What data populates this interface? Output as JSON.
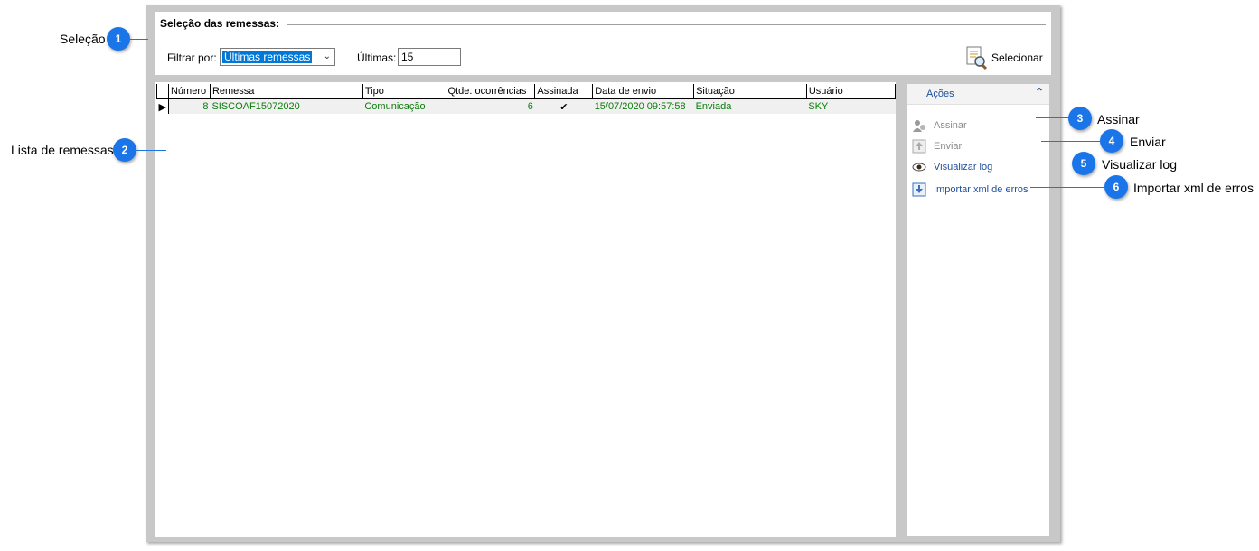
{
  "selection": {
    "title": "Seleção das remessas:",
    "filter_label": "Filtrar por:",
    "filter_value": "Últimas remessas",
    "last_label": "Últimas:",
    "last_value": "15",
    "select_button": "Selecionar"
  },
  "grid": {
    "columns": [
      "Número",
      "Remessa",
      "Tipo",
      "Qtde. ocorrências",
      "Assinada",
      "Data de envio",
      "Situação",
      "Usuário"
    ],
    "rows": [
      {
        "numero": "8",
        "remessa": "SISCOAF15072020",
        "tipo": "Comunicação",
        "qtde": "6",
        "assinada": "✔",
        "data": "15/07/2020 09:57:58",
        "situacao": "Enviada",
        "usuario": "SKY"
      }
    ]
  },
  "actions": {
    "header": "Ações",
    "items": [
      {
        "label": "Assinar",
        "icon": "signature-icon",
        "enabled": false
      },
      {
        "label": "Enviar",
        "icon": "upload-icon",
        "enabled": false
      },
      {
        "label": "Visualizar log",
        "icon": "eye-icon",
        "enabled": true
      },
      {
        "label": "Importar xml de erros",
        "icon": "import-icon",
        "enabled": true
      }
    ]
  },
  "callouts": [
    {
      "num": "1",
      "text": "Seleção"
    },
    {
      "num": "2",
      "text": "Lista de remessas"
    },
    {
      "num": "3",
      "text": "Assinar"
    },
    {
      "num": "4",
      "text": "Enviar"
    },
    {
      "num": "5",
      "text": "Visualizar log"
    },
    {
      "num": "6",
      "text": "Importar xml de erros"
    }
  ],
  "colors": {
    "accent": "#1a75e8",
    "link": "#1f4e9c",
    "row_text": "#0a7d0a"
  }
}
